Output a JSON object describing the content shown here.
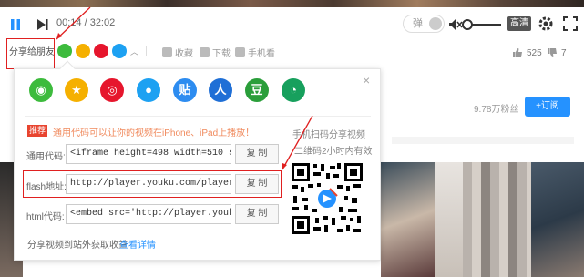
{
  "player": {
    "time": "00:14 / 32:02",
    "barrage_label": "弹",
    "quality_label": "高清"
  },
  "share": {
    "label": "分享给朋友",
    "actions": {
      "favorite": "收藏",
      "download": "下载",
      "mobile": "手机看"
    },
    "likes": "525",
    "dislikes": "7"
  },
  "channel": {
    "fans": "9.78万粉丝",
    "subscribe_label": "+订阅"
  },
  "popup": {
    "close": "×",
    "share_icons": [
      {
        "name": "wechat",
        "color": "#3dbb3d"
      },
      {
        "name": "favorites",
        "color": "#f5b000"
      },
      {
        "name": "weibo",
        "color": "#e6162d"
      },
      {
        "name": "qq",
        "color": "#1da1f2"
      },
      {
        "name": "tieba",
        "color": "#2d8cf0"
      },
      {
        "name": "renren",
        "color": "#1f6fd6"
      },
      {
        "name": "douban",
        "color": "#2a9e3a"
      },
      {
        "name": "qzone",
        "color": "#17a05d"
      }
    ],
    "icon_glyphs": {
      "tieba": "贴",
      "renren": "人",
      "douban": "豆"
    },
    "recommend_tag": "推荐",
    "recommend_tip": "通用代码可以让你的视频在iPhone、iPad上播放！",
    "rows": [
      {
        "label": "通用代码:",
        "value": "<iframe height=498 width=510 src='http",
        "copy": "复 制"
      },
      {
        "label": "flash地址:",
        "value": "http://player.youku.com/player.php/sid/XN",
        "copy": "复 制"
      },
      {
        "label": "html代码:",
        "value": "<embed src='http://player.youku.com/pla",
        "copy": "复 制"
      }
    ],
    "qr_title": "手机扫码分享视频",
    "qr_subtitle": "二维码2小时内有效",
    "footer_text": "分享视频到站外获取收益",
    "footer_link": "查看详情"
  }
}
